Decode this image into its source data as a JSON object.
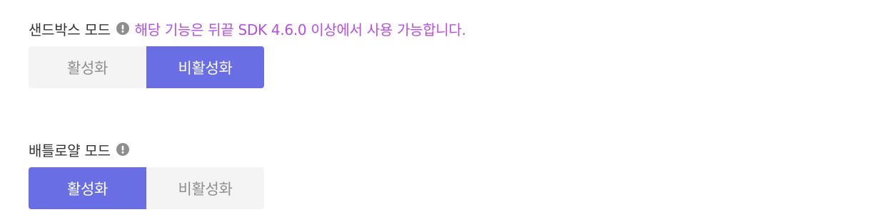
{
  "sandbox": {
    "title": "샌드박스 모드",
    "notice": "해당 기능은 뒤끝 SDK 4.6.0 이상에서 사용 가능합니다.",
    "enable_label": "활성화",
    "disable_label": "비활성화",
    "selected": "disable"
  },
  "battle_royale": {
    "title": "배틀로얄 모드",
    "enable_label": "활성화",
    "disable_label": "비활성화",
    "selected": "enable"
  },
  "colors": {
    "accent": "#6a6ee4",
    "notice": "#b64ee6",
    "inactive_bg": "#f4f4f4",
    "inactive_text": "#8f8f8f",
    "icon_gray": "#8e8e8e"
  },
  "icons": {
    "info": "exclamation-circle-icon"
  }
}
